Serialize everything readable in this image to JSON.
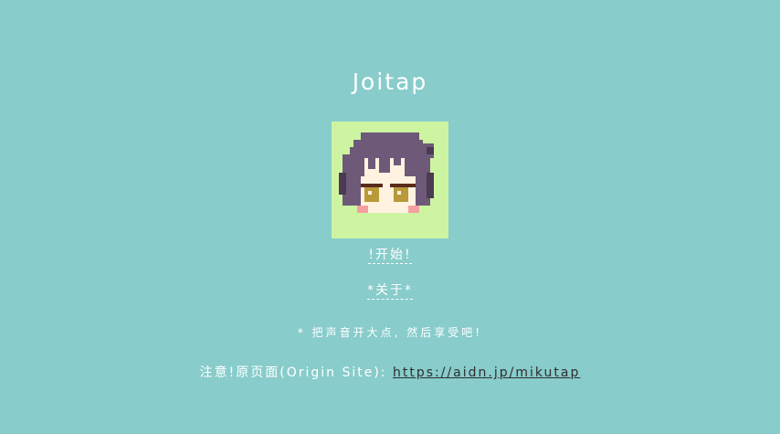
{
  "app": {
    "title": "Joitap"
  },
  "menu": {
    "start_label": "!开始!",
    "about_label": "*关于*"
  },
  "hint": "* 把声音开大点, 然后享受吧!",
  "note": {
    "prefix": "注意!原页面(Origin Site):",
    "link_text": "https://aidn.jp/mikutap"
  },
  "avatar": {
    "icon": "pixel-chibi-character",
    "colors": {
      "background": "#cdf5a1",
      "hair": "#6e5a78",
      "hair_dark": "#4a3a52",
      "skin": "#fff2e0",
      "eye": "#b89a3a",
      "eyelid": "#5a2a1a",
      "blush": "#f4a0a0"
    }
  },
  "theme": {
    "background": "#88cccb",
    "text": "#ffffff",
    "link": "#2e2e2e"
  }
}
